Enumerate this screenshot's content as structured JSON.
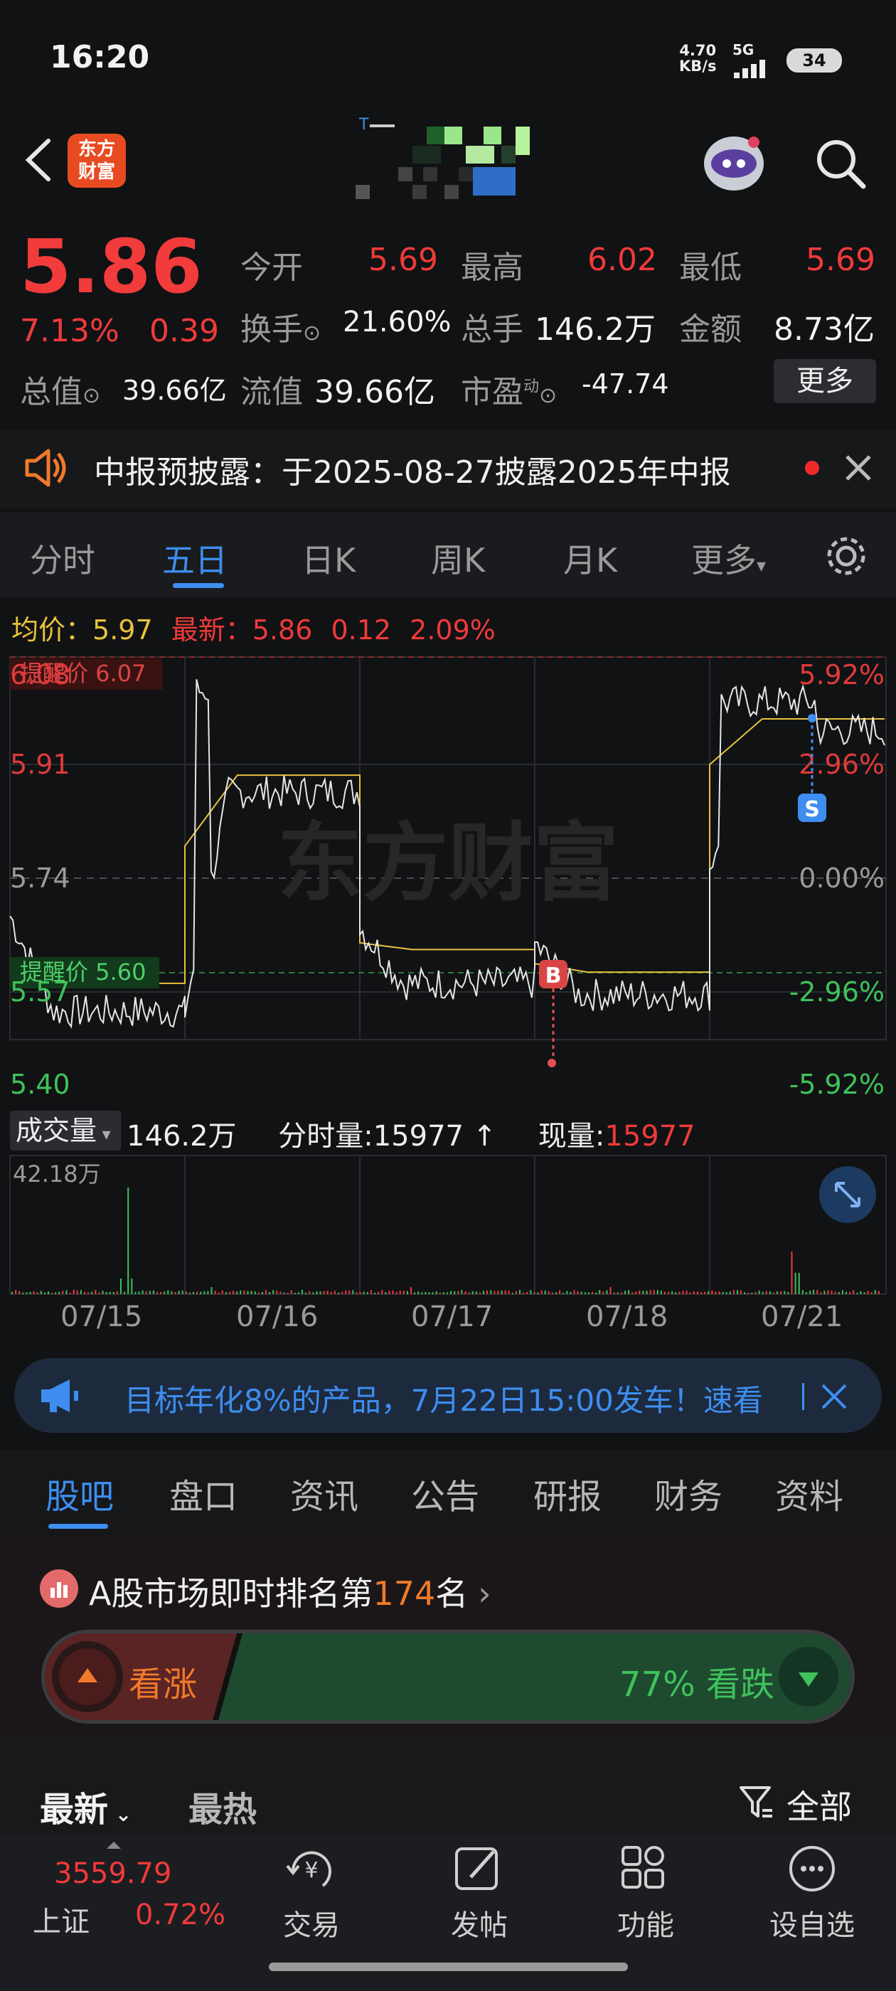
{
  "status_bar": {
    "time": "16:20",
    "net_speed_value": "4.70",
    "net_speed_unit": "KB/s",
    "network": "5G",
    "battery": "34"
  },
  "header": {
    "logo_text_line1": "东方",
    "logo_text_line2": "财富"
  },
  "quote": {
    "price": "5.86",
    "change_pct": "7.13%",
    "change": "0.39",
    "open_label": "今开",
    "open": "5.69",
    "high_label": "最高",
    "high": "6.02",
    "low_label": "最低",
    "low": "5.69",
    "turnover_label": "换手",
    "turnover": "21.60%",
    "volume_label": "总手",
    "volume": "146.2万",
    "amount_label": "金额",
    "amount": "8.73亿",
    "total_cap_label": "总值",
    "total_cap": "39.66亿",
    "float_cap_label": "流值",
    "float_cap": "39.66亿",
    "pe_label": "市盈",
    "pe_sup": "动",
    "pe": "-47.74",
    "more_label": "更多"
  },
  "notice": {
    "text": "中报预披露：于2025-08-27披露2025年中报"
  },
  "chart_tabs": [
    "分时",
    "五日",
    "日K",
    "周K",
    "月K",
    "更多"
  ],
  "summary": {
    "avg_label": "均价：",
    "avg": "5.97",
    "latest_label": "最新：",
    "latest": "5.86",
    "change": "0.12",
    "change_pct": "2.09%"
  },
  "chart": {
    "watermark": "东方财富",
    "alert_high": "提醒价 6.07",
    "alert_low": "提醒价 5.60",
    "marker_b": "B",
    "marker_s": "S",
    "left_ticks": [
      "6.08",
      "5.91",
      "5.74",
      "5.57",
      "5.40"
    ],
    "right_ticks": [
      "5.92%",
      "2.96%",
      "0.00%",
      "-2.96%",
      "-5.92%"
    ],
    "volume_max": "42.18万",
    "dates": [
      "07/15",
      "07/16",
      "07/17",
      "07/18",
      "07/21"
    ]
  },
  "volume_bar": {
    "selector": "成交量",
    "total": "146.2万",
    "tick_label": "分时量:",
    "tick_value": "15977 ↑",
    "now_label": "现量:",
    "now_value": "15977"
  },
  "chart_data": {
    "type": "line",
    "title": "",
    "x": [
      "07/15",
      "07/16",
      "07/17",
      "07/18",
      "07/21"
    ],
    "ylim": [
      5.4,
      6.08
    ],
    "series": [
      {
        "name": "",
        "values": [
          5.45,
          5.84,
          5.5,
          5.48,
          6.0
        ]
      },
      {
        "name": "",
        "values": [
          5.5,
          5.87,
          5.56,
          5.52,
          5.97
        ]
      }
    ]
  },
  "ad": {
    "text": "目标年化8%的产品，7月22日15:00发车！速看"
  },
  "section_tabs": [
    "股吧",
    "盘口",
    "资讯",
    "公告",
    "研报",
    "财务",
    "资料"
  ],
  "ranking": {
    "prefix": "A股市场即时排名第",
    "rank": "174",
    "suffix": "名",
    "up_label": "看涨",
    "down_pct": "77%",
    "down_label": "看跌"
  },
  "feed": {
    "latest": "最新",
    "hot": "最热",
    "filter": "全部"
  },
  "bottom_bar": {
    "index_value": "3559.79",
    "index_name": "上证",
    "index_change": "0.72%",
    "trade": "交易",
    "post": "发帖",
    "functions": "功能",
    "watchlist": "设自选"
  },
  "colors": {
    "up": "#f03a3a",
    "down": "#3fc25a",
    "accent": "#3d8ef0",
    "avg_line": "#e8c23c"
  }
}
